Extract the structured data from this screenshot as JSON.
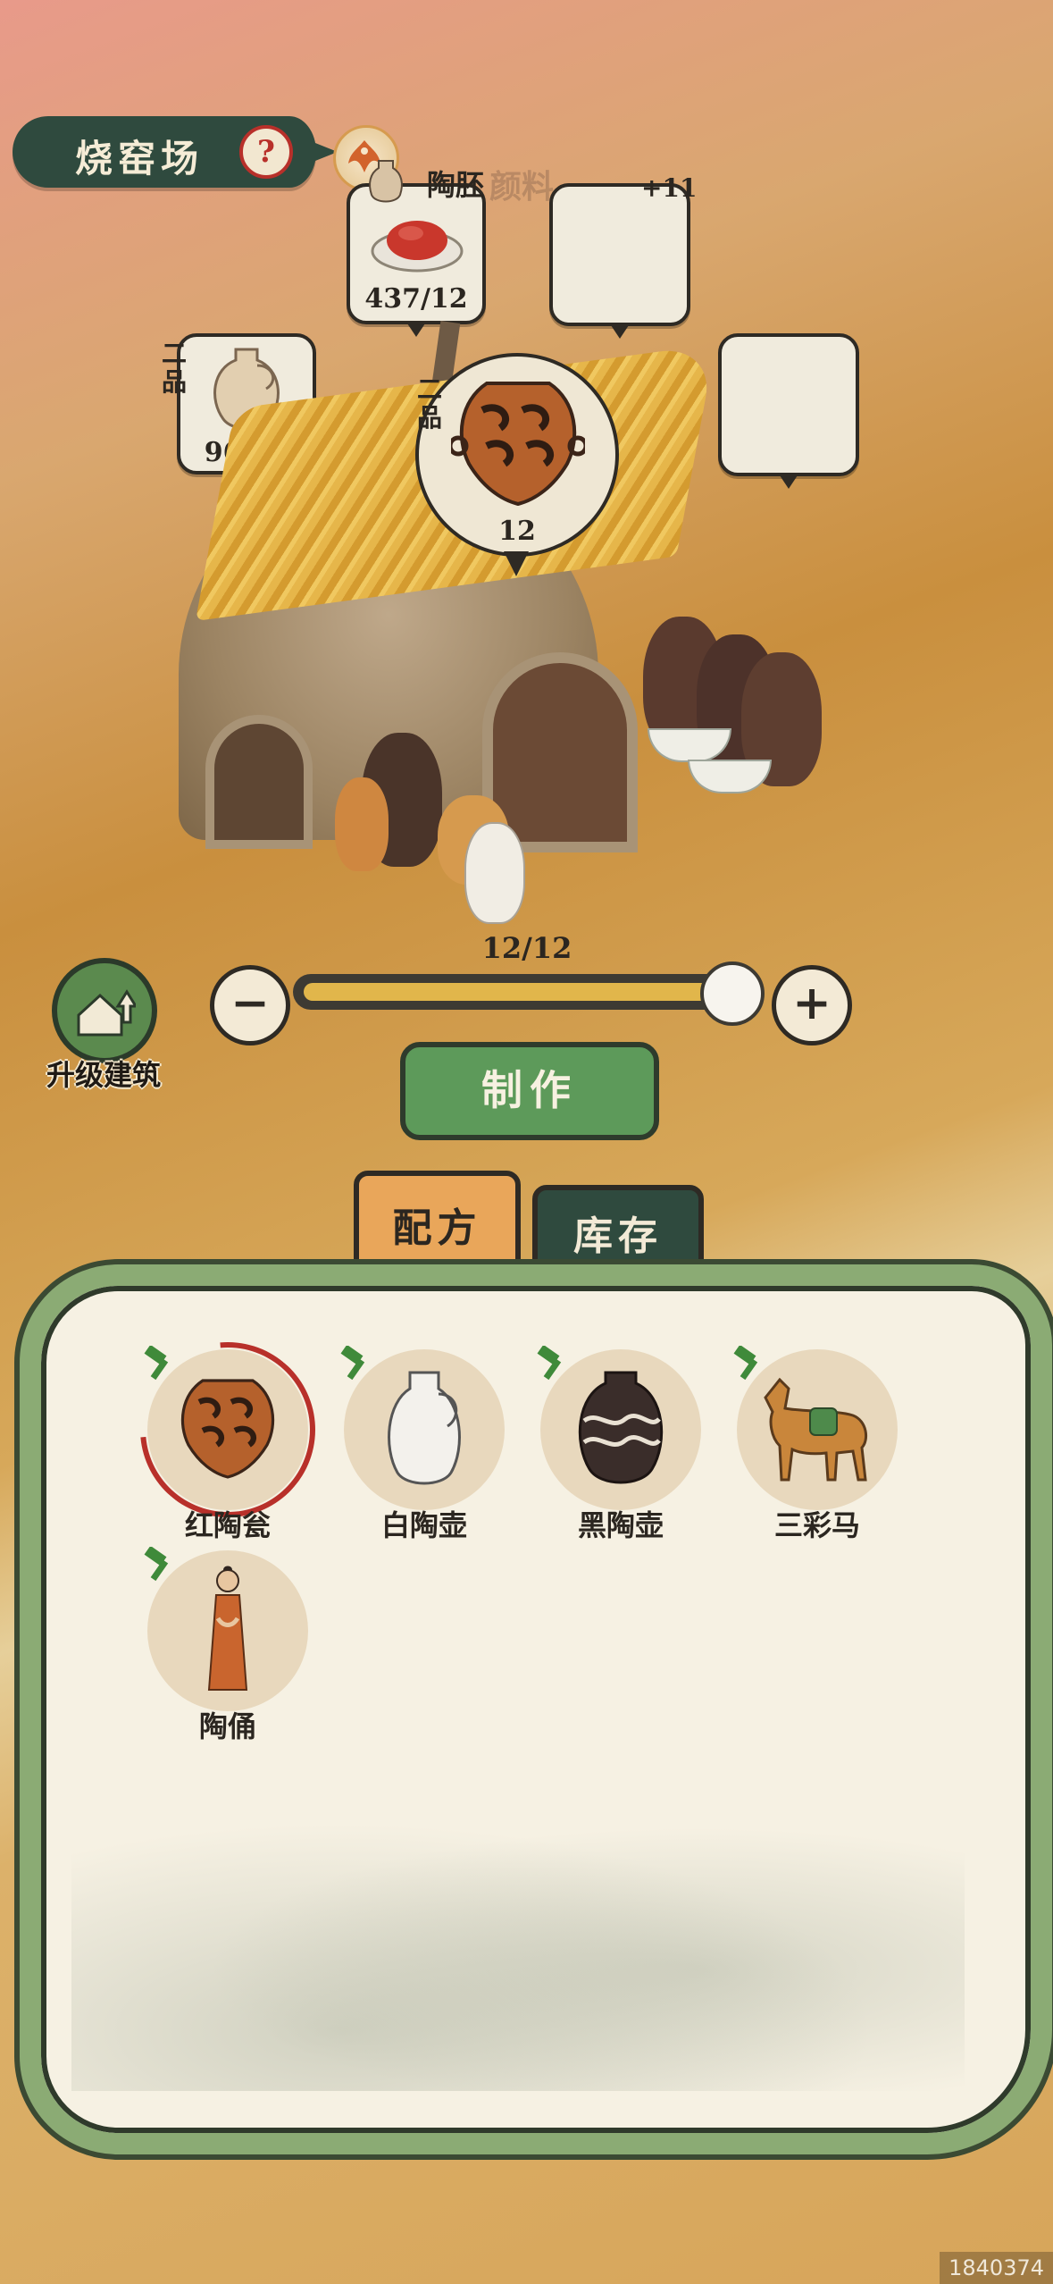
{
  "header": {
    "title": "烧窑场",
    "help_label": "?"
  },
  "resources": {
    "pigment": {
      "name": "陶胚",
      "faded_label": "颜料",
      "count": "437/12"
    },
    "extra_slot": {
      "badge": "+11"
    },
    "clay_pot": {
      "grade": "二品",
      "count": "96/12"
    },
    "current_product": {
      "grade": "二品",
      "count": "12"
    }
  },
  "controls": {
    "slider_count": "12/12",
    "slider_fraction": 0.96,
    "minus_label": "−",
    "plus_label": "+",
    "upgrade_label": "升级建筑",
    "make_label": "制作"
  },
  "tabs": [
    {
      "label": "配方",
      "active": true
    },
    {
      "label": "库存",
      "active": false
    }
  ],
  "recipes": [
    {
      "name": "红陶瓮",
      "selected": true
    },
    {
      "name": "白陶壶",
      "selected": false
    },
    {
      "name": "黑陶壶",
      "selected": false
    },
    {
      "name": "三彩马",
      "selected": false
    },
    {
      "name": "陶俑",
      "selected": false
    }
  ],
  "watermark": "1840374",
  "colors": {
    "accent_green": "#5d9a5a",
    "banner_dark": "#2f4a3e",
    "selected_red": "#b8302a",
    "tab_active": "#e9a65a"
  }
}
